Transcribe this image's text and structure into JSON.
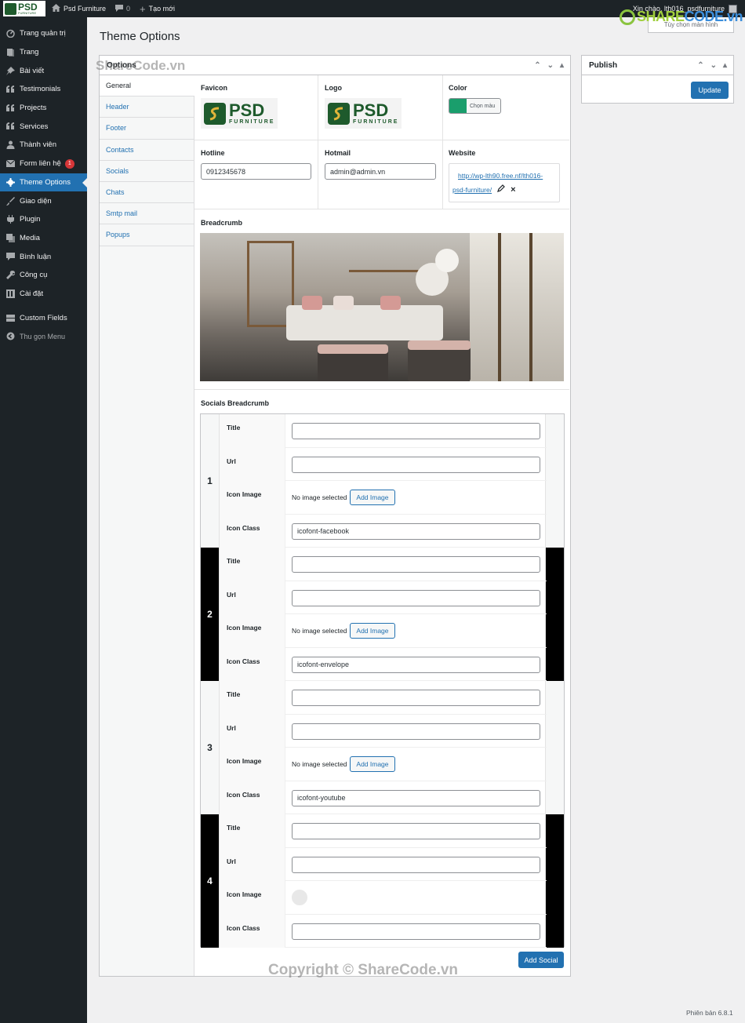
{
  "adminbar": {
    "logo_big": "PSD",
    "logo_small": "FURNITURE",
    "site_name": "Psd Furniture",
    "comments_count": "0",
    "new_label": "Tạo mới",
    "greeting": "Xin chào, lth016_psdfurniture"
  },
  "watermarks": {
    "top_share": "SHARE",
    "top_code": "CODE.vn",
    "mid": "ShareCode.vn",
    "bottom": "Copyright © ShareCode.vn"
  },
  "screen_options": "Tùy chọn màn hình",
  "sidebar": {
    "items": [
      {
        "label": "Trang quản trị",
        "icon": "dashboard-icon"
      },
      {
        "label": "Trang",
        "icon": "pages-icon"
      },
      {
        "label": "Bài viết",
        "icon": "pin-icon"
      },
      {
        "label": "Testimonials",
        "icon": "quote-icon"
      },
      {
        "label": "Projects",
        "icon": "quote-icon"
      },
      {
        "label": "Services",
        "icon": "quote-icon"
      },
      {
        "label": "Thành viên",
        "icon": "user-icon"
      },
      {
        "label": "Form liên hệ",
        "icon": "mail-icon",
        "badge": "1"
      },
      {
        "label": "Theme Options",
        "icon": "gear-icon",
        "active": true
      },
      {
        "label": "Giao diện",
        "icon": "brush-icon"
      },
      {
        "label": "Plugin",
        "icon": "plugin-icon"
      },
      {
        "label": "Media",
        "icon": "media-icon"
      },
      {
        "label": "Bình luận",
        "icon": "comment-icon"
      },
      {
        "label": "Công cụ",
        "icon": "wrench-icon"
      },
      {
        "label": "Cài đặt",
        "icon": "settings-icon"
      },
      {
        "label": "Custom Fields",
        "icon": "fields-icon"
      }
    ],
    "collapse_label": "Thu gọn Menu"
  },
  "page_title": "Theme Options",
  "options_box": {
    "title": "Options",
    "tabs": [
      "General",
      "Header",
      "Footer",
      "Contacts",
      "Socials",
      "Chats",
      "Smtp mail",
      "Popups"
    ],
    "favicon_label": "Favicon",
    "logo_label": "Logo",
    "color_label": "Color",
    "color_button_label": "Chọn màu",
    "color_value": "#1a9e6c",
    "hotline_label": "Hotline",
    "hotline_value": "0912345678",
    "hotmail_label": "Hotmail",
    "hotmail_value": "admin@admin.vn",
    "website_label": "Website",
    "website_line1": "http://wp-lth90.free.nf/lth016-",
    "website_line2": "psd-furniture/",
    "breadcrumb_label": "Breadcrumb",
    "socials_label": "Socials Breadcrumb",
    "add_social_label": "Add Social"
  },
  "repeater": {
    "field_labels": {
      "title": "Title",
      "url": "Url",
      "icon_image": "Icon Image",
      "icon_class": "Icon Class"
    },
    "no_image_text": "No image selected",
    "add_image_label": "Add Image",
    "rows": [
      {
        "num": "1",
        "icon_class": "icofont-facebook"
      },
      {
        "num": "2",
        "icon_class": "icofont-envelope"
      },
      {
        "num": "3",
        "icon_class": "icofont-youtube"
      },
      {
        "num": "4",
        "icon_class": ""
      }
    ]
  },
  "publish": {
    "title": "Publish",
    "update_label": "Update"
  },
  "version": "Phiên bản 6.8.1"
}
